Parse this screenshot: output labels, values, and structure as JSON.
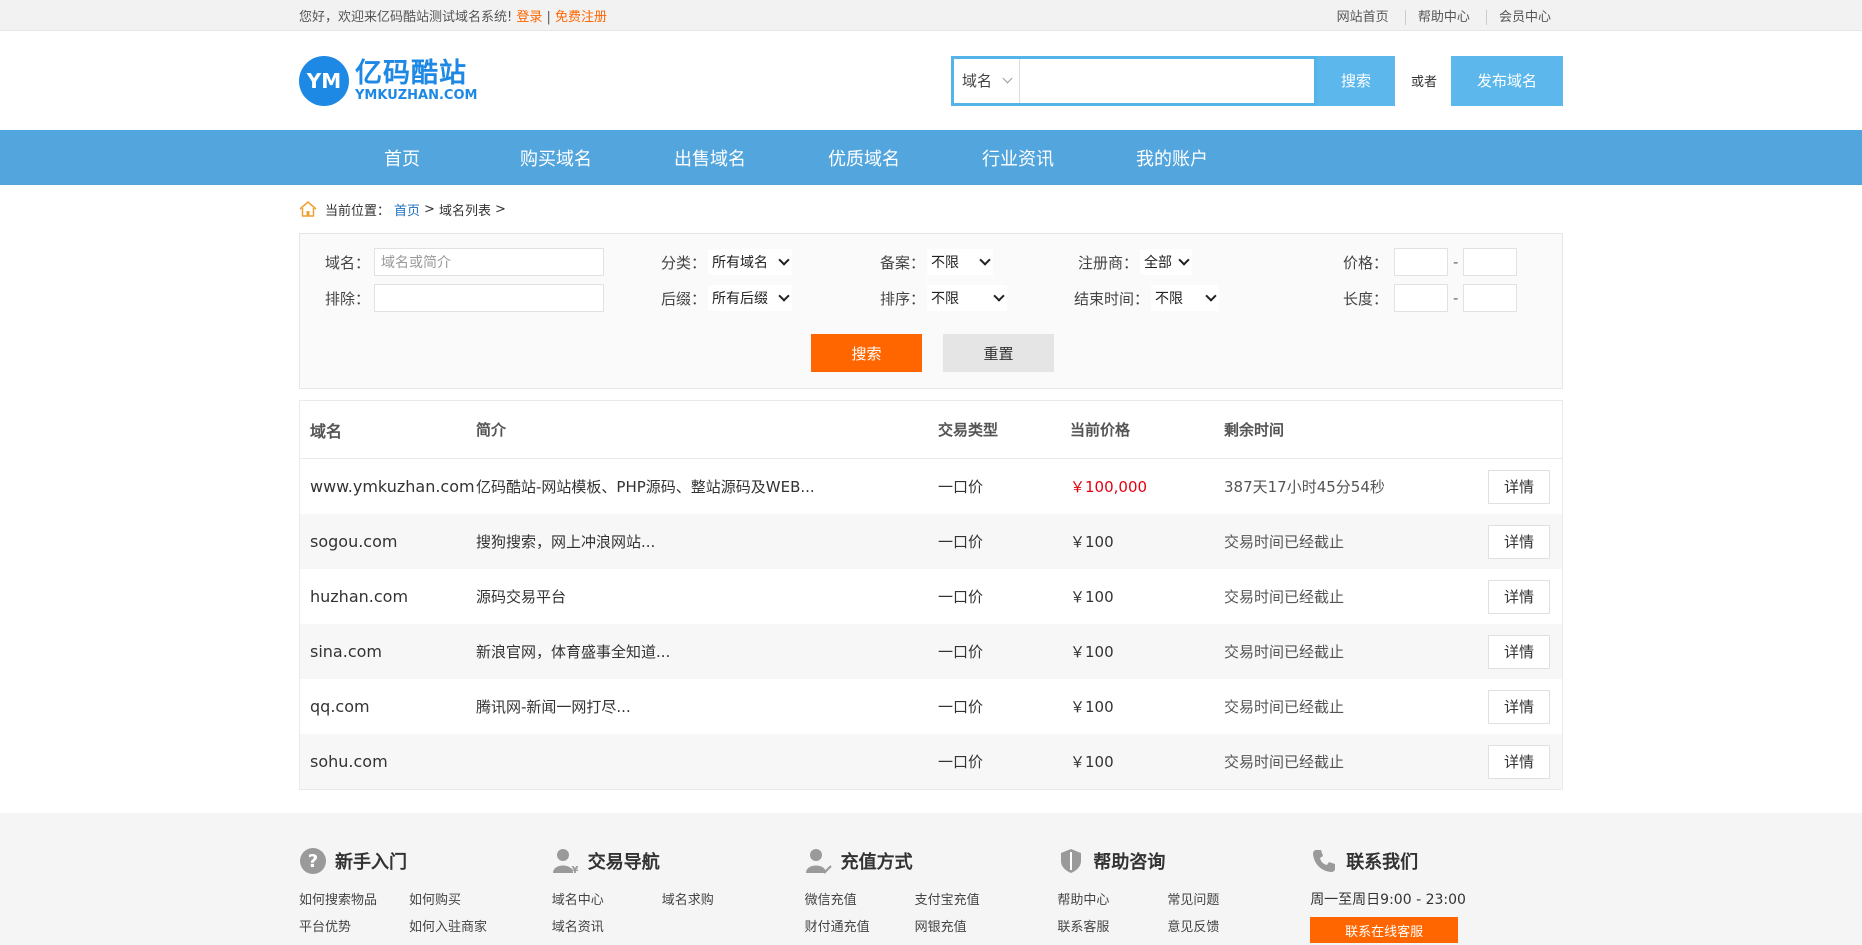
{
  "topbar": {
    "welcome": "您好，欢迎来亿码酷站测试域名系统!",
    "login": "登录",
    "sep": "|",
    "register": "免费注册",
    "links": [
      "网站首页",
      "帮助中心",
      "会员中心"
    ]
  },
  "header": {
    "logo_cn": "亿码酷站",
    "logo_en": "YMKUZHAN.COM",
    "logo_mark": "YM",
    "search_select": "域名",
    "search_button": "搜索",
    "or_text": "或者",
    "publish_button": "发布域名"
  },
  "nav": [
    "首页",
    "购买域名",
    "出售域名",
    "优质域名",
    "行业资讯",
    "我的账户"
  ],
  "breadcrumb": {
    "label": "当前位置：",
    "home": "首页",
    "sep1": ">",
    "current": "域名列表",
    "sep2": ">"
  },
  "filter": {
    "domain_label": "域名：",
    "domain_placeholder": "域名或简介",
    "exclude_label": "排除：",
    "category_label": "分类：",
    "category_value": "所有域名",
    "suffix_label": "后缀：",
    "suffix_value": "所有后缀",
    "record_label": "备案：",
    "record_value": "不限",
    "sort_label": "排序：",
    "sort_value": "不限",
    "registrar_label": "注册商：",
    "registrar_value": "全部",
    "endtime_label": "结束时间：",
    "endtime_value": "不限",
    "price_label": "价格：",
    "length_label": "长度：",
    "dash": "-",
    "search_button": "搜索",
    "reset_button": "重置"
  },
  "table": {
    "headers": [
      "域名",
      "简介",
      "交易类型",
      "当前价格",
      "剩余时间"
    ],
    "detail_label": "详情",
    "rows": [
      {
        "domain": "www.ymkuzhan.com",
        "desc": "亿码酷站-网站模板、PHP源码、整站源码及WEB...",
        "type": "一口价",
        "price": "￥100,000",
        "remaining": "387天17小时45分54秒",
        "highlight": true
      },
      {
        "domain": "sogou.com",
        "desc": "搜狗搜索，网上冲浪网站...",
        "type": "一口价",
        "price": "￥100",
        "remaining": "交易时间已经截止",
        "highlight": false
      },
      {
        "domain": "huzhan.com",
        "desc": "源码交易平台",
        "type": "一口价",
        "price": "￥100",
        "remaining": "交易时间已经截止",
        "highlight": false
      },
      {
        "domain": "sina.com",
        "desc": "新浪官网，体育盛事全知道...",
        "type": "一口价",
        "price": "￥100",
        "remaining": "交易时间已经截止",
        "highlight": false
      },
      {
        "domain": "qq.com",
        "desc": "腾讯网-新闻一网打尽...",
        "type": "一口价",
        "price": "￥100",
        "remaining": "交易时间已经截止",
        "highlight": false
      },
      {
        "domain": "sohu.com",
        "desc": "",
        "type": "一口价",
        "price": "￥100",
        "remaining": "交易时间已经截止",
        "highlight": false
      }
    ]
  },
  "footer": {
    "columns": [
      {
        "title": "新手入门",
        "icon": "question-icon",
        "links": [
          "如何搜索物品",
          "如何购买",
          "平台优势",
          "如何入驻商家"
        ]
      },
      {
        "title": "交易导航",
        "icon": "user-yen-icon",
        "links": [
          "域名中心",
          "域名求购",
          "域名资讯"
        ]
      },
      {
        "title": "充值方式",
        "icon": "user-edit-icon",
        "links": [
          "微信充值",
          "支付宝充值",
          "财付通充值",
          "网银充值"
        ]
      },
      {
        "title": "帮助咨询",
        "icon": "shield-icon",
        "links": [
          "帮助中心",
          "常见问题",
          "联系客服",
          "意见反馈"
        ]
      }
    ],
    "contact_title": "联系我们",
    "contact_time": "周一至周日9:00 - 23:00",
    "contact_button": "联系在线客服"
  }
}
